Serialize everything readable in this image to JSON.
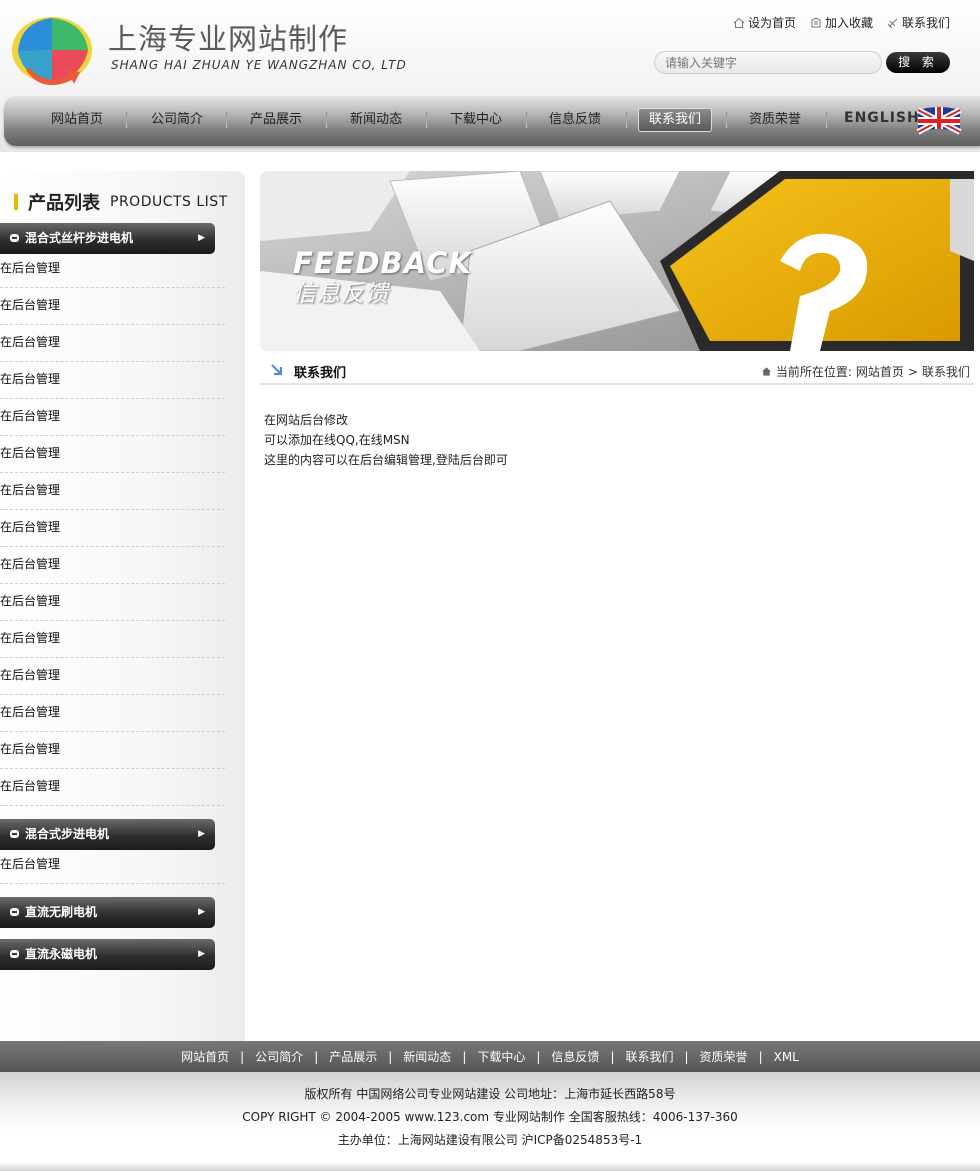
{
  "header": {
    "logo_cn": "上海专业网站制作",
    "logo_en": "SHANG HAI ZHUAN YE WANGZHAN CO, LTD",
    "toplinks": [
      {
        "label": "设为首页",
        "icon": "home-icon"
      },
      {
        "label": "加入收藏",
        "icon": "bookmark-icon"
      },
      {
        "label": "联系我们",
        "icon": "contact-icon"
      }
    ],
    "search": {
      "placeholder": "请输入关键字",
      "button": "搜 索"
    }
  },
  "nav": {
    "items": [
      "网站首页",
      "公司简介",
      "产品展示",
      "新闻动态",
      "下载中心",
      "信息反馈",
      "联系我们",
      "资质荣誉"
    ],
    "active": "联系我们",
    "english": "ENGLISH"
  },
  "sidebar": {
    "title_cn": "产品列表",
    "title_en": "PRODUCTS LIST",
    "categories": [
      {
        "label": "混合式丝杆步进电机",
        "items": [
          "在后台管理",
          "在后台管理",
          "在后台管理",
          "在后台管理",
          "在后台管理",
          "在后台管理",
          "在后台管理",
          "在后台管理",
          "在后台管理",
          "在后台管理",
          "在后台管理",
          "在后台管理",
          "在后台管理",
          "在后台管理",
          "在后台管理"
        ]
      },
      {
        "label": "混合式步进电机",
        "items": [
          "在后台管理"
        ]
      },
      {
        "label": "直流无刷电机",
        "items": []
      },
      {
        "label": "直流永磁电机",
        "items": []
      }
    ]
  },
  "banner": {
    "title_en": "FEEDBACK",
    "title_cn": "信息反馈",
    "key_symbol": "?"
  },
  "crumb": {
    "title": "联系我们",
    "prefix": "当前所在位置:",
    "home": "网站首页",
    "sep": ">",
    "current": "联系我们"
  },
  "content": {
    "lines": [
      "在网站后台修改",
      "可以添加在线QQ,在线MSN",
      "这里的内容可以在后台编辑管理,登陆后台即可"
    ]
  },
  "footer": {
    "nav": [
      "网站首页",
      "公司简介",
      "产品展示",
      "新闻动态",
      "下载中心",
      "信息反馈",
      "联系我们",
      "资质荣誉",
      "XML"
    ],
    "sep": "|",
    "line1": "版权所有 中国网络公司专业网站建设 公司地址：上海市延长西路58号",
    "line2": "COPY RIGHT © 2004-2005 www.123.com 专业网站制作 全国客服热线：4006-137-360",
    "line3": "主办单位：上海网站建设有限公司 沪ICP备0254853号-1"
  },
  "colors": {
    "accent_yellow": "#f0b400",
    "nav_dark": "#5e5e5e",
    "footer_bar": "#666666"
  }
}
